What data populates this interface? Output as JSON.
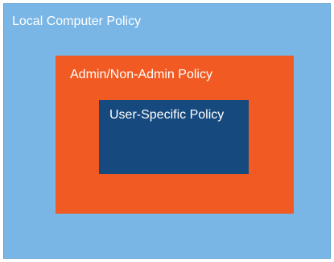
{
  "diagram": {
    "outer": {
      "label": "Local Computer Policy",
      "color": "#79b6e6"
    },
    "middle": {
      "label": "Admin/Non-Admin Policy",
      "color": "#f15a22"
    },
    "inner": {
      "label": "User-Specific Policy",
      "color": "#164a7f"
    }
  }
}
